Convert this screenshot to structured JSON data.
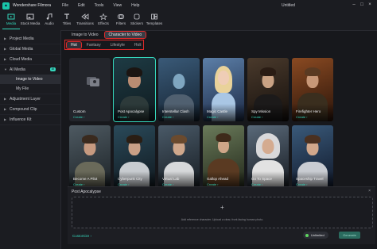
{
  "app": {
    "name": "Wondershare Filmora",
    "document_title": "Untitled"
  },
  "menu": [
    "File",
    "Edit",
    "Tools",
    "View",
    "Help"
  ],
  "toolbar": [
    "Media",
    "Stock Media",
    "Audio",
    "Titles",
    "Transitions",
    "Effects",
    "Filters",
    "Stickers",
    "Templates"
  ],
  "sidebar": {
    "items": [
      "Project Media",
      "Global Media",
      "Cloud Media",
      "AI Media"
    ],
    "ai_badge": "AI",
    "sub_items": [
      "Image to Video",
      "My File"
    ],
    "items_after": [
      "Adjustment Layer",
      "Compound Clip",
      "Influence Kit"
    ]
  },
  "tabs": [
    "Image to Video",
    "Character to Video"
  ],
  "subtabs": [
    "Hot",
    "Fantasy",
    "Lifestyle",
    "Holi"
  ],
  "cards_row1": [
    {
      "title": "Custom",
      "action": "Create"
    },
    {
      "title": "Post Apocalypse",
      "action": "Create"
    },
    {
      "title": "Interstellar Clash",
      "action": "Create"
    },
    {
      "title": "Magic Castle",
      "action": "Create"
    },
    {
      "title": "Spy Mission",
      "action": "Create"
    },
    {
      "title": "Firefighter Hero",
      "action": "Create"
    }
  ],
  "cards_row2": [
    {
      "title": "Become A Pilot",
      "action": "Create"
    },
    {
      "title": "Cyberpunk City",
      "action": "Create"
    },
    {
      "title": "Virtual Lab",
      "action": "Create"
    },
    {
      "title": "Gallop Ahead",
      "action": "Create"
    },
    {
      "title": "Go To Space",
      "action": "Create"
    },
    {
      "title": "Spaceship Travel",
      "action": "Create"
    }
  ],
  "panel": {
    "title": "Post Apocalypse",
    "upload_hint": "Add reference character. Upload a clear, front-facing human photo.",
    "customize": "Customize",
    "unlimited": "Unlimited",
    "generate": "Generate"
  },
  "colors": {
    "accent": "#35d6bb",
    "highlight": "#e02a2a"
  }
}
